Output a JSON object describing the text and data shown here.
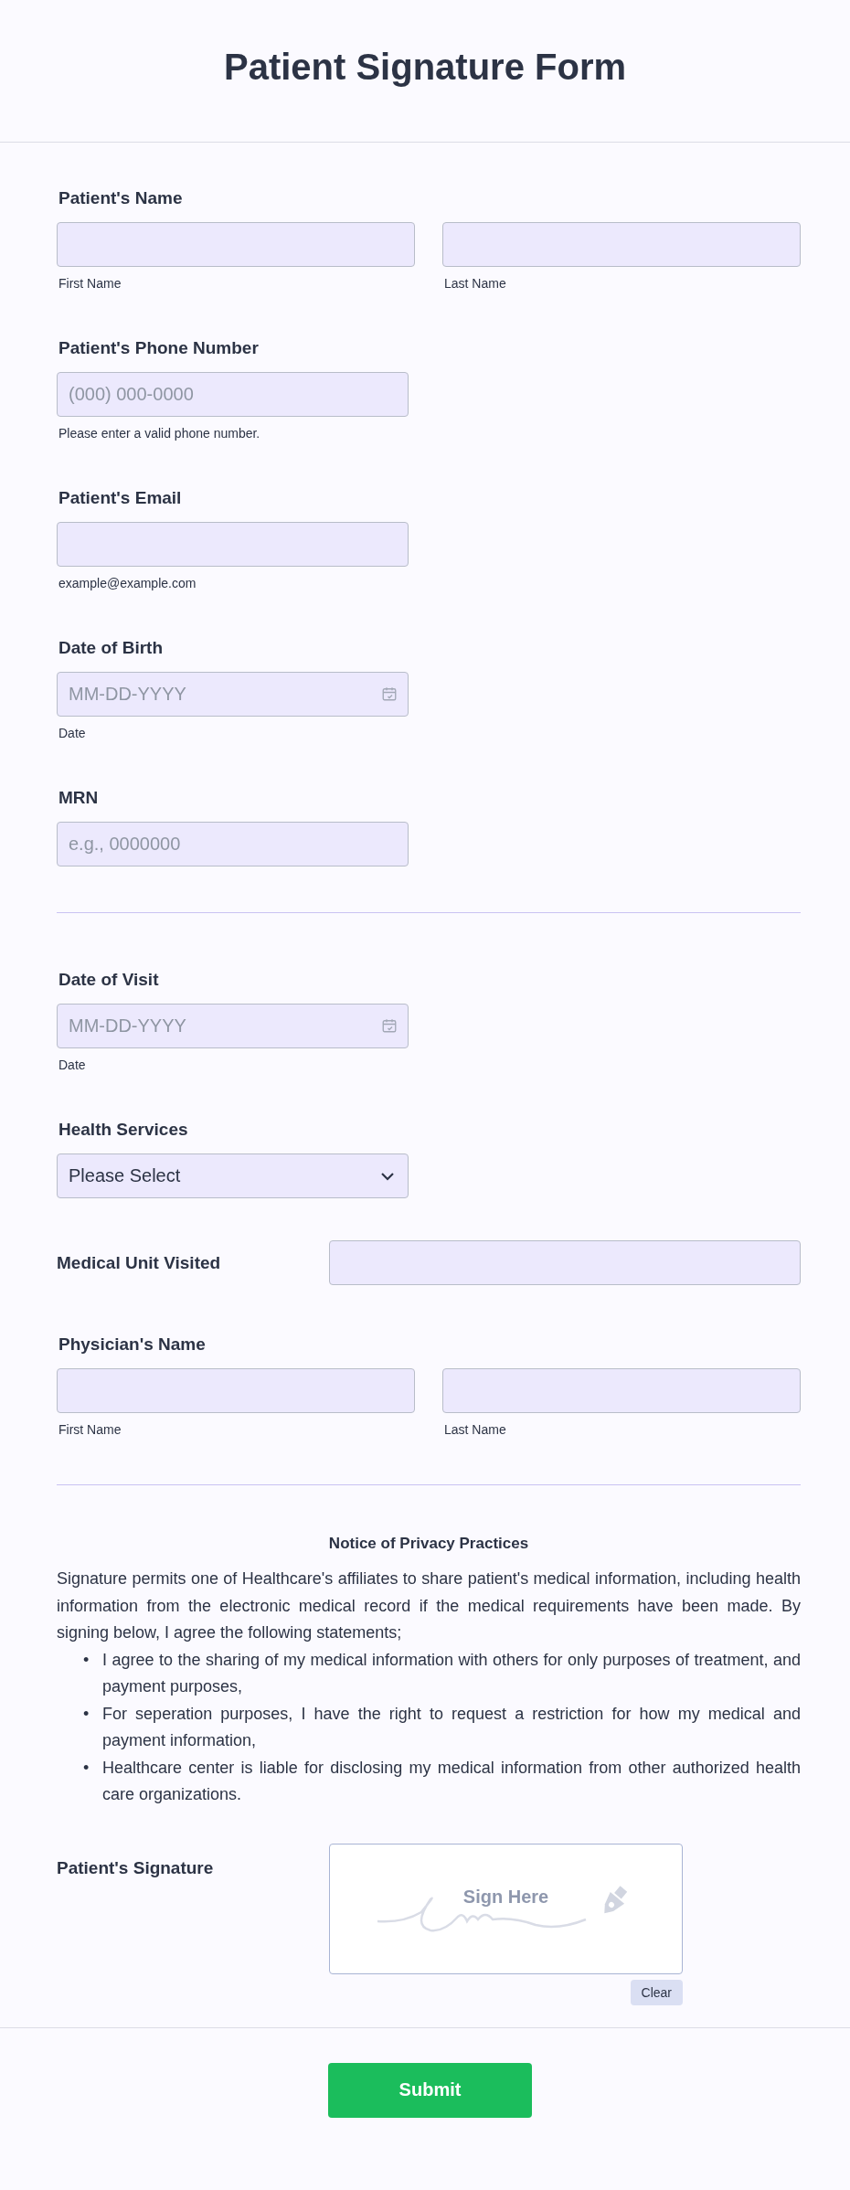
{
  "title": "Patient Signature Form",
  "fields": [
    {
      "kind": "name",
      "label": "Patient's Name",
      "parts": [
        {
          "sublabel": "First Name"
        },
        {
          "sublabel": "Last Name"
        }
      ]
    },
    {
      "kind": "text",
      "label": "Patient's Phone Number",
      "placeholder": "(000) 000-0000",
      "sublabel": "Please enter a valid phone number."
    },
    {
      "kind": "text",
      "label": "Patient's Email",
      "sublabel": "example@example.com"
    },
    {
      "kind": "date",
      "label": "Date of Birth",
      "placeholder": "MM-DD-YYYY",
      "sublabel": "Date"
    },
    {
      "kind": "text",
      "label": "MRN",
      "placeholder": "e.g., 0000000"
    },
    {
      "kind": "divider"
    },
    {
      "kind": "date",
      "label": "Date of Visit",
      "placeholder": "MM-DD-YYYY",
      "sublabel": "Date"
    },
    {
      "kind": "select",
      "label": "Health Services",
      "value": "Please Select"
    },
    {
      "kind": "inline",
      "label": "Medical Unit Visited"
    },
    {
      "kind": "name",
      "label": "Physician's Name",
      "parts": [
        {
          "sublabel": "First Name"
        },
        {
          "sublabel": "Last Name"
        }
      ]
    },
    {
      "kind": "divider"
    }
  ],
  "notice": {
    "title": "Notice of Privacy Practices",
    "paragraph": "Signature permits one of Healthcare's affiliates to share patient's medical information, including health information from the electronic medical record if the medical requirements have been made. By signing below, I agree the following statements;",
    "bullets": [
      {
        "marker": "•",
        "text": "I agree to the sharing of my medical information with others for only purposes of treatment, and payment purposes,"
      },
      {
        "marker": "•",
        "text": "For seperation purposes, I have the right to request a restriction for how my medical and payment information,"
      },
      {
        "marker": "•",
        "text": "Healthcare center is liable for disclosing my medical information from other authorized health care organizations."
      }
    ]
  },
  "signature": {
    "label": "Patient's Signature",
    "hint": "Sign Here",
    "clear": "Clear"
  },
  "submit": "Submit"
}
